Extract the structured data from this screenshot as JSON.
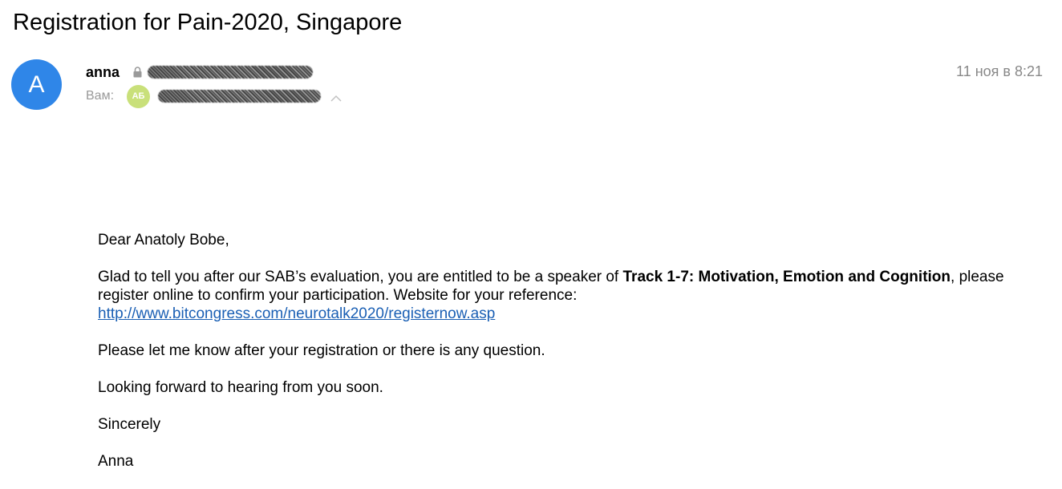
{
  "email": {
    "subject": "Registration for Pain-2020, Singapore",
    "sender": {
      "avatar_letter": "A",
      "avatar_color": "#2f86e8",
      "name": "anna",
      "address_icon": "lock-icon"
    },
    "recipient": {
      "label": "Вам:",
      "avatar_initials": "АБ",
      "avatar_color": "#c9e07a",
      "expand_icon": "chevron-up-icon"
    },
    "date": "11 ноя в 8:21",
    "body": {
      "greeting": "Dear Anatoly Bobe,",
      "main_before": "Glad to tell you after our SAB’s evaluation, you are entitled to be a speaker of ",
      "track": "Track 1-7: Motivation, Emotion and Cognition",
      "main_after": ", please register online to confirm your participation. Website for your reference:",
      "link": "http://www.bitcongress.com/neurotalk2020/registernow.asp",
      "question": "Please let me know after your registration or there is any question.",
      "forward": "Looking forward to hearing from you soon.",
      "sincerely": "Sincerely",
      "signature": "Anna"
    }
  }
}
